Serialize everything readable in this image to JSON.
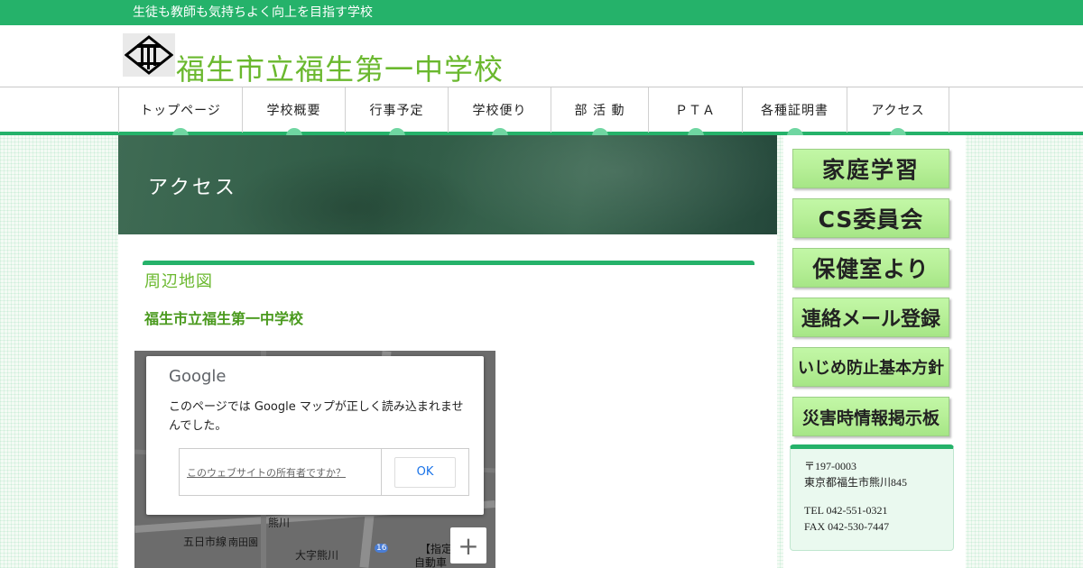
{
  "topbar": {
    "tagline": "生徒も教師も気持ちよく向上を目指す学校"
  },
  "header": {
    "site_title": "福生市立福生第一中学校"
  },
  "nav": [
    {
      "label": "トップページ"
    },
    {
      "label": "学校概要"
    },
    {
      "label": "行事予定"
    },
    {
      "label": "学校便り"
    },
    {
      "label": "部 活 動"
    },
    {
      "label": "ＰＴＡ"
    },
    {
      "label": "各種証明書"
    },
    {
      "label": "アクセス"
    }
  ],
  "page": {
    "hero_title": "アクセス",
    "section_title": "周辺地図",
    "school_name": "福生市立福生第一中学校"
  },
  "map": {
    "provider": "Google",
    "error_message": "このページでは Google マップが正しく読み込まれませんでした。",
    "owner_link": "このウェブサイトの所有者ですか？",
    "ok_label": "OK",
    "zoom_in": "+",
    "labels": [
      "熊川",
      "五日市線",
      "南田園",
      "大字熊川",
      "【指定",
      "自動車",
      "16"
    ]
  },
  "sidebar": {
    "buttons": [
      {
        "label": "家庭学習"
      },
      {
        "label": "CS委員会"
      },
      {
        "label": "保健室より"
      },
      {
        "label": "連絡メール登録"
      },
      {
        "label": "いじめ防止基本方針"
      },
      {
        "label": "災害時情報掲示板"
      }
    ],
    "contact": {
      "postal": "〒197-0003",
      "address": "東京都福生市熊川845",
      "tel": "TEL 042-551-0321",
      "fax": "FAX 042-530-7447"
    }
  },
  "colors": {
    "brand_green": "#25b26a",
    "title_green": "#6ab82e",
    "button_green": "#b8f099"
  }
}
